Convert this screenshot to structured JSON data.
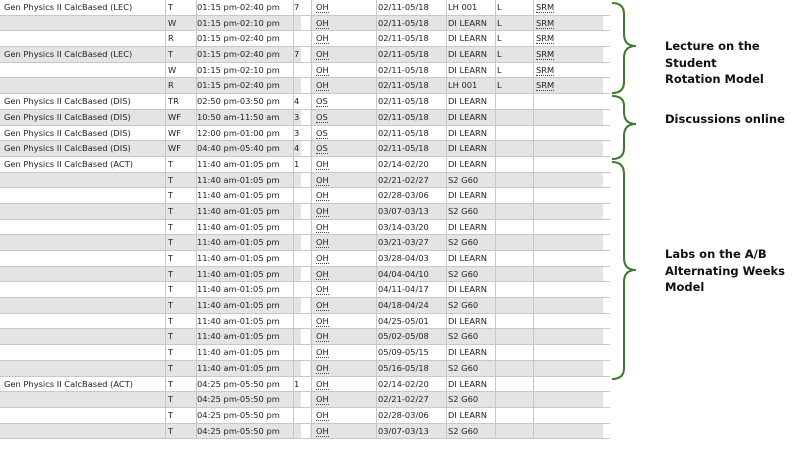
{
  "rows": [
    {
      "title": "Gen Physics II CalcBased (LEC)",
      "days": "T",
      "time": "01:15 pm-02:40 pm",
      "cap": "7",
      "method": "OH",
      "dates": "02/11-05/18",
      "room": "LH 001",
      "l": "L",
      "srm": "SRM"
    },
    {
      "title": "",
      "days": "W",
      "time": "01:15 pm-02:10 pm",
      "cap": "",
      "method": "OH",
      "dates": "02/11-05/18",
      "room": "DI LEARN",
      "l": "L",
      "srm": "SRM"
    },
    {
      "title": "",
      "days": "R",
      "time": "01:15 pm-02:40 pm",
      "cap": "",
      "method": "OH",
      "dates": "02/11-05/18",
      "room": "DI LEARN",
      "l": "L",
      "srm": "SRM"
    },
    {
      "title": "Gen Physics II CalcBased (LEC)",
      "days": "T",
      "time": "01:15 pm-02:40 pm",
      "cap": "7",
      "method": "OH",
      "dates": "02/11-05/18",
      "room": "DI LEARN",
      "l": "L",
      "srm": "SRM"
    },
    {
      "title": "",
      "days": "W",
      "time": "01:15 pm-02:10 pm",
      "cap": "",
      "method": "OH",
      "dates": "02/11-05/18",
      "room": "DI LEARN",
      "l": "L",
      "srm": "SRM"
    },
    {
      "title": "",
      "days": "R",
      "time": "01:15 pm-02:40 pm",
      "cap": "",
      "method": "OH",
      "dates": "02/11-05/18",
      "room": "LH 001",
      "l": "L",
      "srm": "SRM"
    },
    {
      "title": "Gen Physics II CalcBased (DIS)",
      "days": "TR",
      "time": "02:50 pm-03:50 pm",
      "cap": "4",
      "method": "OS",
      "dates": "02/11-05/18",
      "room": "DI LEARN",
      "l": "",
      "srm": ""
    },
    {
      "title": "Gen Physics II CalcBased (DIS)",
      "days": "WF",
      "time": "10:50 am-11:50 am",
      "cap": "3",
      "method": "OS",
      "dates": "02/11-05/18",
      "room": "DI LEARN",
      "l": "",
      "srm": ""
    },
    {
      "title": "Gen Physics II CalcBased (DIS)",
      "days": "WF",
      "time": "12:00 pm-01:00 pm",
      "cap": "3",
      "method": "OS",
      "dates": "02/11-05/18",
      "room": "DI LEARN",
      "l": "",
      "srm": ""
    },
    {
      "title": "Gen Physics II CalcBased (DIS)",
      "days": "WF",
      "time": "04:40 pm-05:40 pm",
      "cap": "4",
      "method": "OS",
      "dates": "02/11-05/18",
      "room": "DI LEARN",
      "l": "",
      "srm": ""
    },
    {
      "title": "Gen Physics II CalcBased (ACT)",
      "days": "T",
      "time": "11:40 am-01:05 pm",
      "cap": "1",
      "method": "OH",
      "dates": "02/14-02/20",
      "room": "DI LEARN",
      "l": "",
      "srm": ""
    },
    {
      "title": "",
      "days": "T",
      "time": "11:40 am-01:05 pm",
      "cap": "",
      "method": "OH",
      "dates": "02/21-02/27",
      "room": "S2 G60",
      "l": "",
      "srm": ""
    },
    {
      "title": "",
      "days": "T",
      "time": "11:40 am-01:05 pm",
      "cap": "",
      "method": "OH",
      "dates": "02/28-03/06",
      "room": "DI LEARN",
      "l": "",
      "srm": ""
    },
    {
      "title": "",
      "days": "T",
      "time": "11:40 am-01:05 pm",
      "cap": "",
      "method": "OH",
      "dates": "03/07-03/13",
      "room": "S2 G60",
      "l": "",
      "srm": ""
    },
    {
      "title": "",
      "days": "T",
      "time": "11:40 am-01:05 pm",
      "cap": "",
      "method": "OH",
      "dates": "03/14-03/20",
      "room": "DI LEARN",
      "l": "",
      "srm": ""
    },
    {
      "title": "",
      "days": "T",
      "time": "11:40 am-01:05 pm",
      "cap": "",
      "method": "OH",
      "dates": "03/21-03/27",
      "room": "S2 G60",
      "l": "",
      "srm": ""
    },
    {
      "title": "",
      "days": "T",
      "time": "11:40 am-01:05 pm",
      "cap": "",
      "method": "OH",
      "dates": "03/28-04/03",
      "room": "DI LEARN",
      "l": "",
      "srm": ""
    },
    {
      "title": "",
      "days": "T",
      "time": "11:40 am-01:05 pm",
      "cap": "",
      "method": "OH",
      "dates": "04/04-04/10",
      "room": "S2 G60",
      "l": "",
      "srm": ""
    },
    {
      "title": "",
      "days": "T",
      "time": "11:40 am-01:05 pm",
      "cap": "",
      "method": "OH",
      "dates": "04/11-04/17",
      "room": "DI LEARN",
      "l": "",
      "srm": ""
    },
    {
      "title": "",
      "days": "T",
      "time": "11:40 am-01:05 pm",
      "cap": "",
      "method": "OH",
      "dates": "04/18-04/24",
      "room": "S2 G60",
      "l": "",
      "srm": ""
    },
    {
      "title": "",
      "days": "T",
      "time": "11:40 am-01:05 pm",
      "cap": "",
      "method": "OH",
      "dates": "04/25-05/01",
      "room": "DI LEARN",
      "l": "",
      "srm": ""
    },
    {
      "title": "",
      "days": "T",
      "time": "11:40 am-01:05 pm",
      "cap": "",
      "method": "OH",
      "dates": "05/02-05/08",
      "room": "S2 G60",
      "l": "",
      "srm": ""
    },
    {
      "title": "",
      "days": "T",
      "time": "11:40 am-01:05 pm",
      "cap": "",
      "method": "OH",
      "dates": "05/09-05/15",
      "room": "DI LEARN",
      "l": "",
      "srm": ""
    },
    {
      "title": "",
      "days": "T",
      "time": "11:40 am-01:05 pm",
      "cap": "",
      "method": "OH",
      "dates": "05/16-05/18",
      "room": "S2 G60",
      "l": "",
      "srm": ""
    },
    {
      "title": "Gen Physics II CalcBased (ACT)",
      "days": "T",
      "time": "04:25 pm-05:50 pm",
      "cap": "1",
      "method": "OH",
      "dates": "02/14-02/20",
      "room": "DI LEARN",
      "l": "",
      "srm": ""
    },
    {
      "title": "",
      "days": "T",
      "time": "04:25 pm-05:50 pm",
      "cap": "",
      "method": "OH",
      "dates": "02/21-02/27",
      "room": "S2 G60",
      "l": "",
      "srm": ""
    },
    {
      "title": "",
      "days": "T",
      "time": "04:25 pm-05:50 pm",
      "cap": "",
      "method": "OH",
      "dates": "02/28-03/06",
      "room": "DI LEARN",
      "l": "",
      "srm": ""
    },
    {
      "title": "",
      "days": "T",
      "time": "04:25 pm-05:50 pm",
      "cap": "",
      "method": "OH",
      "dates": "03/07-03/13",
      "room": "S2 G60",
      "l": "",
      "srm": ""
    }
  ],
  "annotations": {
    "lecture": [
      "Lecture on the Student",
      "Rotation Model"
    ],
    "discussions": [
      "Discussions online"
    ],
    "labs": [
      "Labs on the A/B",
      "Alternating Weeks",
      "Model"
    ]
  },
  "colors": {
    "shaded": "#e4e4e4",
    "brace": "#3e7a2a",
    "grid": "#c8c8c8"
  }
}
